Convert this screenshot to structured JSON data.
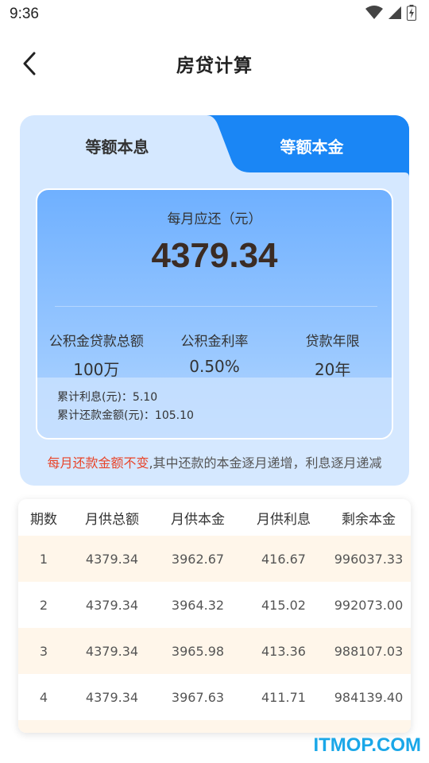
{
  "status_bar": {
    "time": "9:36",
    "icons": [
      "wifi-icon",
      "cellular-signal-icon",
      "battery-charging-icon"
    ]
  },
  "header": {
    "back_icon": "chevron-left-icon",
    "title": "房贷计算"
  },
  "tabs": [
    {
      "label": "等额本息",
      "active": false
    },
    {
      "label": "等额本金",
      "active": true
    }
  ],
  "result": {
    "monthly_label": "每月应还（元）",
    "monthly_amount": "4379.34",
    "stats": [
      {
        "label": "公积金贷款总额",
        "value": "100万"
      },
      {
        "label": "公积金利率",
        "value": "0.50%"
      },
      {
        "label": "贷款年限",
        "value": "20年"
      }
    ],
    "total_interest": "累计利息(元)：5.10",
    "total_repayment": "累计还款金额(元)：105.10"
  },
  "note": {
    "highlight": "每月还款金额不变",
    "rest": ",其中还款的本金逐月递增，利息逐月递减"
  },
  "table": {
    "headers": [
      "期数",
      "月供总额",
      "月供本金",
      "月供利息",
      "剩余本金"
    ],
    "rows": [
      [
        "1",
        "4379.34",
        "3962.67",
        "416.67",
        "996037.33"
      ],
      [
        "2",
        "4379.34",
        "3964.32",
        "415.02",
        "992073.00"
      ],
      [
        "3",
        "4379.34",
        "3965.98",
        "413.36",
        "988107.03"
      ],
      [
        "4",
        "4379.34",
        "3967.63",
        "411.71",
        "984139.40"
      ]
    ]
  },
  "watermark": "ITMOP.COM",
  "colors": {
    "accent_blue": "#1a86f5",
    "card_bg": "#d5e8ff",
    "highlight_red": "#e8452a",
    "row_tint": "#fff6ea"
  }
}
